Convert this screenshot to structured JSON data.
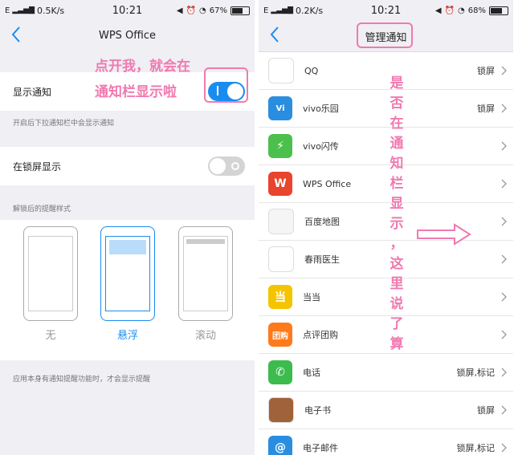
{
  "left": {
    "status": {
      "net": "E",
      "speed": "0.5K/s",
      "time": "10:21",
      "battery": "67%"
    },
    "title": "WPS Office",
    "show_notification": {
      "label": "显示通知",
      "enabled": true
    },
    "hint_pull": "开启后下拉通知栏中会显示通知",
    "lockscreen": {
      "label": "在锁屏显示",
      "enabled": false
    },
    "style_header": "解锁后的提醒样式",
    "styles": [
      {
        "label": "无",
        "selected": false
      },
      {
        "label": "悬浮",
        "selected": true
      },
      {
        "label": "滚动",
        "selected": false
      }
    ],
    "footer_hint": "应用本身有通知提醒功能时，才会显示提醒",
    "annotation_line1": "点开我，就会在",
    "annotation_line2": "通知栏显示啦"
  },
  "right": {
    "status": {
      "net": "E",
      "speed": "0.2K/s",
      "time": "10:21",
      "battery": "68%"
    },
    "title": "管理通知",
    "apps": [
      {
        "name": "QQ",
        "status": "锁屏",
        "icon": "qq-icon",
        "color": "#ffffff"
      },
      {
        "name": "vivo乐园",
        "status": "锁屏",
        "icon": "vivo-paradise-icon",
        "color": "#2a8ee0"
      },
      {
        "name": "vivo闪传",
        "status": "",
        "icon": "vivo-flash-icon",
        "color": "#4cc04c"
      },
      {
        "name": "WPS Office",
        "status": "",
        "icon": "wps-icon",
        "color": "#e8442e"
      },
      {
        "name": "百度地图",
        "status": "",
        "icon": "baidu-map-icon",
        "color": "#f5f5f5"
      },
      {
        "name": "春雨医生",
        "status": "",
        "icon": "chunyu-icon",
        "color": "#ffffff"
      },
      {
        "name": "当当",
        "status": "",
        "icon": "dangdang-icon",
        "color": "#f5c400"
      },
      {
        "name": "点评团购",
        "status": "",
        "icon": "dianping-icon",
        "color": "#ff7a1a"
      },
      {
        "name": "电话",
        "status": "锁屏,标记",
        "icon": "phone-icon",
        "color": "#3dbb4e"
      },
      {
        "name": "电子书",
        "status": "锁屏",
        "icon": "ebook-icon",
        "color": "#a0623a"
      },
      {
        "name": "电子邮件",
        "status": "锁屏,标记",
        "icon": "email-icon",
        "color": "#2a8ee0"
      }
    ],
    "icon_glyphs": {
      "vivo-paradise-icon": "Vi",
      "vivo-flash-icon": "⚡",
      "wps-icon": "W",
      "dangdang-icon": "当",
      "dianping-icon": "团购",
      "phone-icon": "✆",
      "email-icon": "@"
    },
    "annotation_vertical": "是否在通知栏显示，这里说了算"
  }
}
